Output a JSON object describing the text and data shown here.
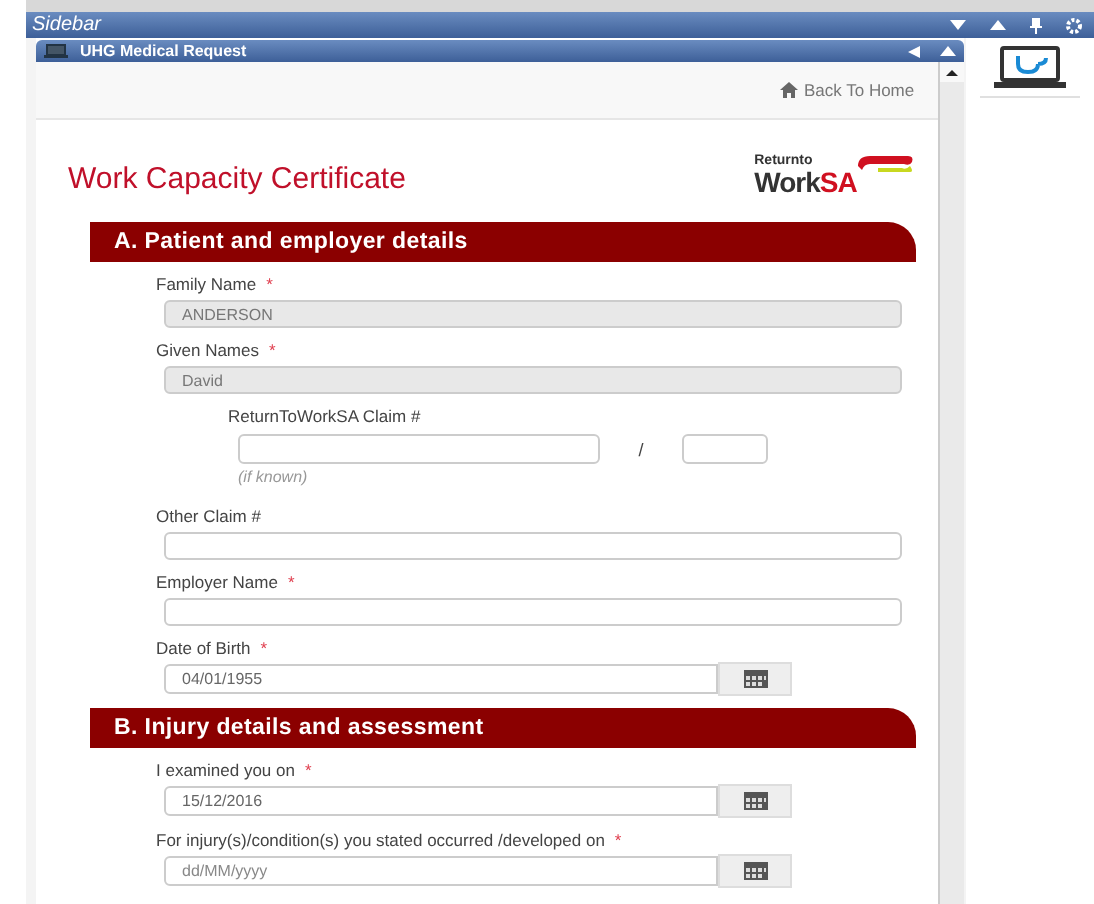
{
  "sidebar": {
    "title": "Sidebar"
  },
  "panel": {
    "title": "UHG Medical Request"
  },
  "back_link": "Back To Home",
  "form_title": "Work Capacity Certificate",
  "logo": {
    "small": "Returnto",
    "big_a": "Work",
    "big_b": "SA"
  },
  "sections": [
    {
      "title": "A. Patient and employer details",
      "fields": [
        {
          "kind": "text",
          "label": "Family Name",
          "marker": "*",
          "value": "ANDERSON",
          "disabled": true
        },
        {
          "kind": "text",
          "label": "Given Names",
          "marker": "*",
          "value": "David",
          "disabled": true
        },
        {
          "kind": "claim",
          "label": "ReturnToWorkSA Claim #",
          "separator": "/",
          "hint": "(if known)"
        },
        {
          "kind": "text",
          "label": "Other Claim #",
          "disabled": false
        },
        {
          "kind": "text",
          "label": "Employer Name",
          "marker": "*",
          "disabled": false
        },
        {
          "kind": "date",
          "label": "Date of Birth",
          "marker": "*",
          "value": "04/01/1955"
        }
      ]
    },
    {
      "title": "B. Injury details and assessment",
      "fields": [
        {
          "kind": "date",
          "label": "I examined you on",
          "marker": "*",
          "value": "15/12/2016"
        },
        {
          "kind": "date",
          "label": "For injury(s)/condition(s) you stated occurred /developed on",
          "marker": "*",
          "placeholder": "dd/MM/yyyy"
        }
      ]
    }
  ]
}
